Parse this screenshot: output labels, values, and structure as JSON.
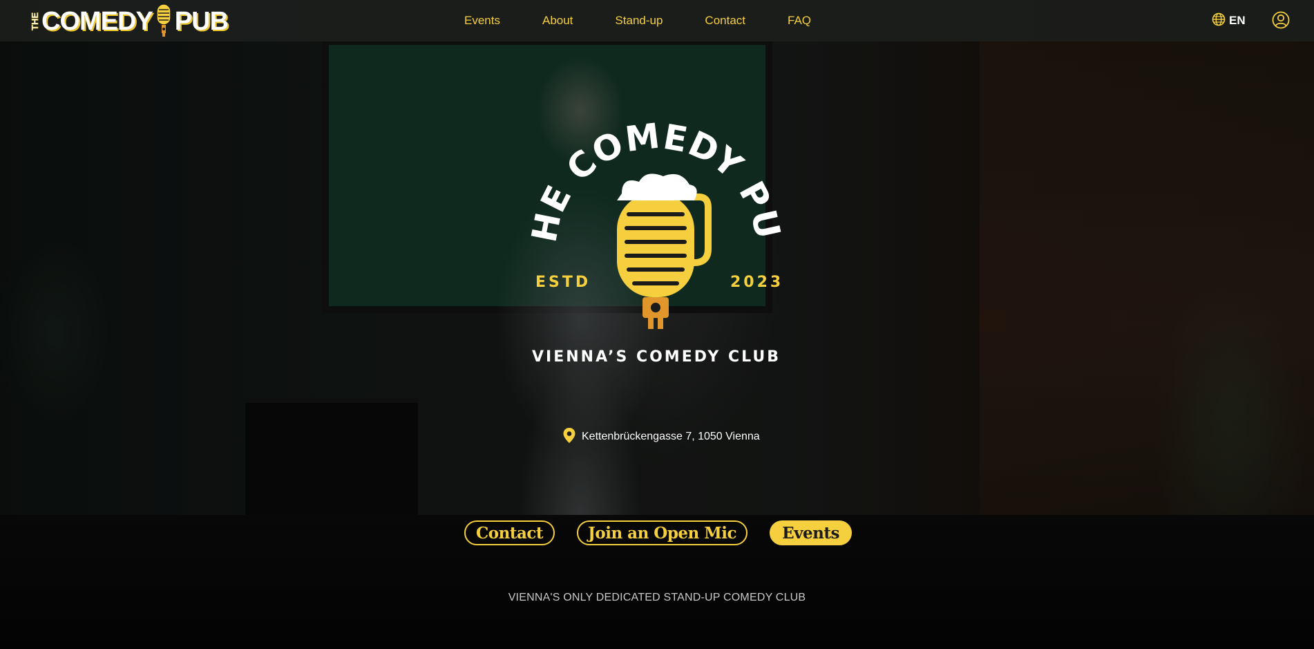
{
  "brand": {
    "the": "THE",
    "word1": "COMEDY",
    "word2": "PUB",
    "accent_color": "#f5cf3d"
  },
  "nav": {
    "links": [
      {
        "label": "Events"
      },
      {
        "label": "About"
      },
      {
        "label": "Stand-up"
      },
      {
        "label": "Contact"
      },
      {
        "label": "FAQ"
      }
    ],
    "language": "EN",
    "language_icon": "globe-icon",
    "user_icon": "user-circle-icon"
  },
  "hero": {
    "logo": {
      "arc_text": "THE COMEDY PUB",
      "estd_label": "ESTD",
      "estd_year": "2023"
    },
    "tagline": "VIENNA’S COMEDY CLUB",
    "address": "Kettenbrückengasse 7, 1050 Vienna",
    "address_icon": "map-pin-icon",
    "buttons": {
      "contact": "Contact",
      "open_mic": "Join an Open Mic",
      "events": "Events"
    },
    "slogan": "VIENNA'S ONLY DEDICATED STAND-UP COMEDY CLUB"
  }
}
